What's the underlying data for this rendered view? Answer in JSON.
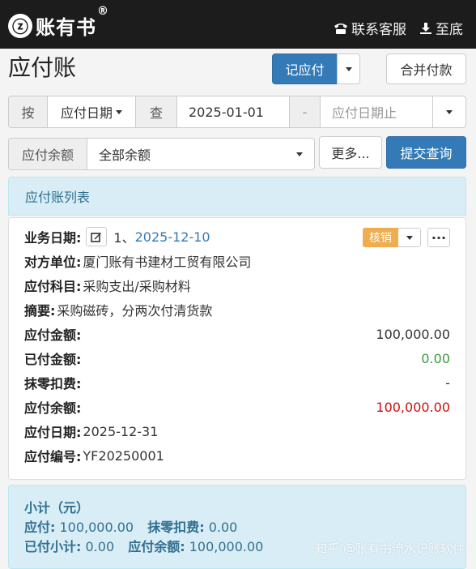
{
  "header": {
    "logo_mark": "ⓩ",
    "logo_text": "账有书",
    "logo_reg": "®",
    "nav": [
      {
        "label": "联系客服",
        "icon": "phone-icon"
      },
      {
        "label": "至底",
        "icon": "download-icon"
      }
    ]
  },
  "page": {
    "title": "应付账",
    "record_button": "记应付",
    "merge_button": "合并付款"
  },
  "filter": {
    "by_label": "按",
    "date_type": "应付日期",
    "query_label": "查",
    "date_from": "2025-01-01",
    "date_separator": "-",
    "date_to_placeholder": "应付日期止",
    "balance_label": "应付余额",
    "balance_option": "全部余额",
    "more_button": "更多...",
    "submit_button": "提交查询"
  },
  "list": {
    "title": "应付账列表"
  },
  "record": {
    "business_date_label": "业务日期:",
    "index": "1、",
    "business_date": "2025-12-10",
    "writeoff_button": "核销",
    "counterparty_label": "对方单位:",
    "counterparty": "厦门账有书建材工贸有限公司",
    "subject_label": "应付科目:",
    "subject": "采购支出/采购材料",
    "summary_label": "摘要:",
    "summary": "采购磁砖，分两次付清货款",
    "amount_label": "应付金额:",
    "amount": "100,000.00",
    "paid_label": "已付金额:",
    "paid": "0.00",
    "discount_label": "抹零扣费:",
    "discount": "-",
    "balance_label": "应付余额:",
    "balance": "100,000.00",
    "due_date_label": "应付日期:",
    "due_date": "2025-12-31",
    "number_label": "应付编号:",
    "number": "YF20250001"
  },
  "subtotal": {
    "title": "小计（元）",
    "payable_label": "应付:",
    "payable": "100,000.00",
    "discount_label": "抹零扣费:",
    "discount": "0.00",
    "paid_label": "已付小计:",
    "paid": "0.00",
    "balance_label": "应付余额:",
    "balance": "100,000.00"
  },
  "watermark": "知乎 @账有书流水记账软件",
  "colors": {
    "topbar": "#1c1c1c",
    "primary": "#337ab7",
    "info_bg": "#d9edf7",
    "info_text": "#31708f",
    "warning": "#f0ad4e",
    "green": "#3c9a3c",
    "red": "#cc1010"
  }
}
